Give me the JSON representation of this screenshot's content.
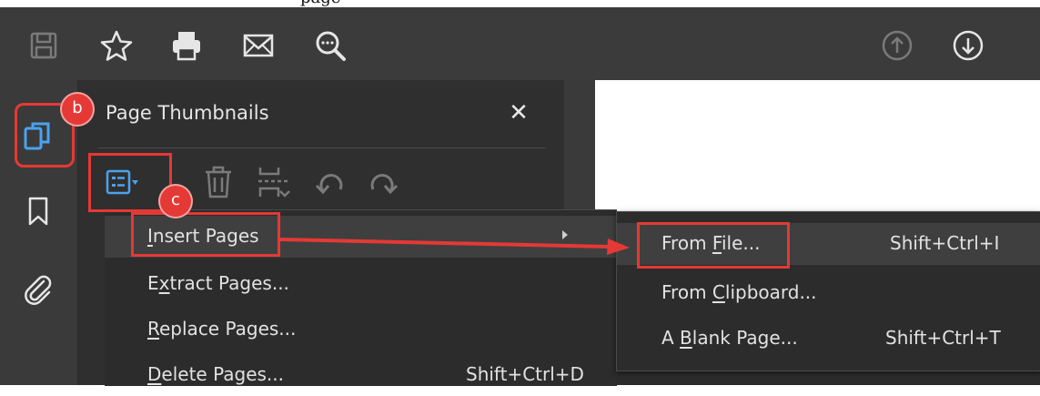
{
  "top_strip": {
    "text": "page"
  },
  "toolbar": {
    "icons": [
      "save-icon",
      "star-icon",
      "print-icon",
      "email-icon",
      "zoom-icon",
      "page-up-icon",
      "page-down-icon"
    ]
  },
  "rail": {
    "icons": [
      "page-thumbnails-icon",
      "bookmark-icon",
      "attachment-icon"
    ]
  },
  "panel": {
    "title": "Page Thumbnails",
    "close_label": "✕",
    "tool_icons": [
      "options-menu-icon",
      "delete-icon",
      "split-icon",
      "rotate-left-icon",
      "rotate-right-icon"
    ]
  },
  "menu": {
    "items": [
      {
        "pre": "",
        "key": "I",
        "post": "nsert Pages",
        "shortcut": "",
        "submenu": true
      },
      {
        "pre": "E",
        "key": "x",
        "post": "tract Pages...",
        "shortcut": ""
      },
      {
        "pre": "",
        "key": "R",
        "post": "eplace Pages...",
        "shortcut": ""
      },
      {
        "pre": "",
        "key": "D",
        "post": "elete Pages...",
        "shortcut": "Shift+Ctrl+D"
      }
    ]
  },
  "submenu": {
    "items": [
      {
        "pre": "From ",
        "key": "F",
        "post": "ile...",
        "shortcut": "Shift+Ctrl+I"
      },
      {
        "pre": "From ",
        "key": "C",
        "post": "lipboard...",
        "shortcut": ""
      },
      {
        "pre": "A ",
        "key": "B",
        "post": "lank Page...",
        "shortcut": "Shift+Ctrl+T"
      }
    ]
  },
  "annotations": {
    "badge_b": "b",
    "badge_c": "c"
  },
  "colors": {
    "accent_blue": "#4aa3f0",
    "annotation_red": "#e53935",
    "toolbar_bg": "#3b3b3b"
  }
}
